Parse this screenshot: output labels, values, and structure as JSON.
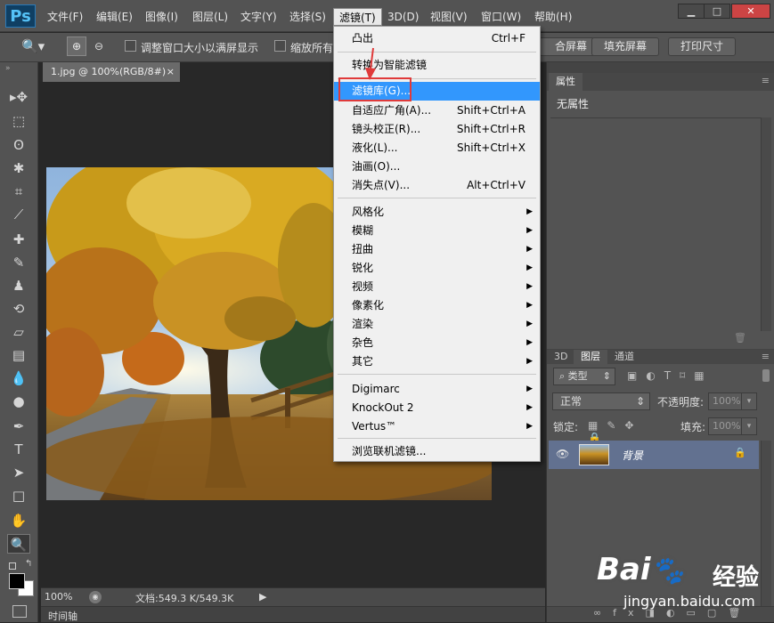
{
  "app": {
    "logo": "Ps"
  },
  "menubar": {
    "items": [
      "文件(F)",
      "编辑(E)",
      "图像(I)",
      "图层(L)",
      "文字(Y)",
      "选择(S)",
      "滤镜(T)",
      "3D(D)",
      "视图(V)",
      "窗口(W)",
      "帮助(H)"
    ]
  },
  "window_controls": {
    "minimize": "▁",
    "maximize": "□",
    "close": "✕"
  },
  "options": {
    "fit_label": "调整窗口大小以满屏显示",
    "zoom_all_label": "缩放所有",
    "fill_screen": "合屏幕",
    "fill_button": "填充屏幕",
    "print_size": "打印尺寸"
  },
  "document": {
    "tab_label": "1.jpg @ 100%(RGB/8#)",
    "tab_close": "×",
    "zoom": "100%",
    "doc_info": "文档:549.3 K/549.3K",
    "timeline_label": "时间轴"
  },
  "filter_menu": {
    "items": [
      {
        "label": "凸出",
        "shortcut": "Ctrl+F"
      },
      {
        "label": "转换为智能滤镜",
        "shortcut": ""
      },
      {
        "label": "滤镜库(G)...",
        "shortcut": ""
      },
      {
        "label": "自适应广角(A)...",
        "shortcut": "Shift+Ctrl+A"
      },
      {
        "label": "镜头校正(R)...",
        "shortcut": "Shift+Ctrl+R"
      },
      {
        "label": "液化(L)...",
        "shortcut": "Shift+Ctrl+X"
      },
      {
        "label": "油画(O)...",
        "shortcut": ""
      },
      {
        "label": "消失点(V)...",
        "shortcut": "Alt+Ctrl+V"
      },
      {
        "label": "风格化",
        "shortcut": ""
      },
      {
        "label": "模糊",
        "shortcut": ""
      },
      {
        "label": "扭曲",
        "shortcut": ""
      },
      {
        "label": "锐化",
        "shortcut": ""
      },
      {
        "label": "视频",
        "shortcut": ""
      },
      {
        "label": "像素化",
        "shortcut": ""
      },
      {
        "label": "渲染",
        "shortcut": ""
      },
      {
        "label": "杂色",
        "shortcut": ""
      },
      {
        "label": "其它",
        "shortcut": ""
      },
      {
        "label": "Digimarc",
        "shortcut": ""
      },
      {
        "label": "KnockOut 2",
        "shortcut": ""
      },
      {
        "label": "Vertus™",
        "shortcut": ""
      },
      {
        "label": "浏览联机滤镜...",
        "shortcut": ""
      }
    ]
  },
  "properties_panel": {
    "tab": "属性",
    "content": "无属性"
  },
  "layers_panel": {
    "tabs": [
      "3D",
      "图层",
      "通道"
    ],
    "filter_kind": "类型",
    "blend_mode": "正常",
    "opacity_label": "不透明度:",
    "opacity_value": "100%",
    "lock_label": "锁定:",
    "fill_label": "填充:",
    "fill_value": "100%",
    "layer_name": "背景"
  },
  "watermark": {
    "brand": "Bai",
    "brand_suffix": "经验",
    "url": "jingyan.baidu.com"
  }
}
